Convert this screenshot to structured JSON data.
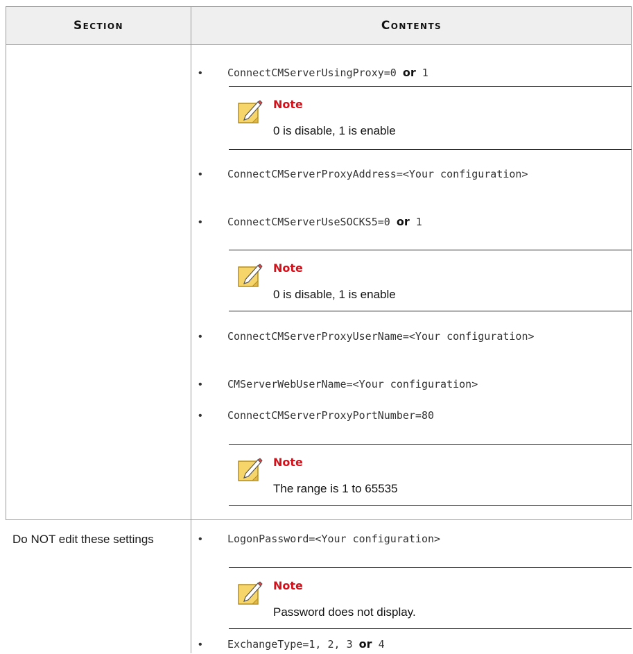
{
  "header": {
    "section": "Section",
    "contents": "Contents"
  },
  "rows": [
    {
      "section": "",
      "items": [
        {
          "type": "bullet",
          "code": "ConnectCMServerUsingProxy=0",
          "or": "or",
          "tail": "1"
        },
        {
          "type": "note",
          "title": "Note",
          "body": "0 is disable, 1 is enable"
        },
        {
          "type": "bullet",
          "code": "ConnectCMServerProxyAddress=<Your configuration>"
        },
        {
          "type": "bullet",
          "code": "ConnectCMServerUseSOCKS5=0",
          "or": "or",
          "tail": "1"
        },
        {
          "type": "note",
          "title": "Note",
          "body": "0 is disable, 1 is enable"
        },
        {
          "type": "bullet",
          "code": "ConnectCMServerProxyUserName=<Your configuration>"
        },
        {
          "type": "bullet",
          "code": "CMServerWebUserName=<Your configuration>"
        },
        {
          "type": "bullet",
          "code": "ConnectCMServerProxyPortNumber=80"
        },
        {
          "type": "note",
          "title": "Note",
          "body": "The range is 1 to 65535"
        }
      ]
    },
    {
      "section": "Do NOT edit these settings",
      "items": [
        {
          "type": "bullet",
          "code": "LogonPassword=<Your configuration>"
        },
        {
          "type": "note",
          "title": "Note",
          "body": "Password does not display."
        },
        {
          "type": "bullet",
          "code": "ExchangeType=1, 2, 3",
          "or": "or",
          "tail": "4"
        }
      ]
    }
  ],
  "icons": {
    "note": "pencil-note-icon"
  },
  "colors": {
    "note_title": "#d4101a",
    "header_bg": "#efefef",
    "grid": "#9a9a9a"
  }
}
